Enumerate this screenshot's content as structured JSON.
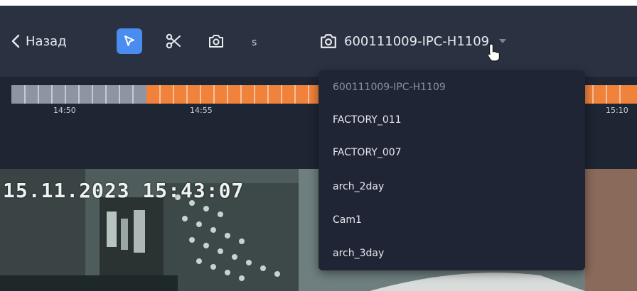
{
  "toolbar": {
    "back_label": "Назад",
    "s_label": "s",
    "camera_name": "600111009-IPC-H1109"
  },
  "timeline": {
    "labels": [
      "14:50",
      "14:55",
      "15:10"
    ],
    "colors": {
      "recorded": "#f0823c",
      "empty": "#8d95a3"
    }
  },
  "video": {
    "overlay_text": "15.11.2023 15:43:07"
  },
  "dropdown": {
    "items": [
      "600111009-IPC-H1109",
      "FACTORY_011",
      "FACTORY_007",
      "arch_2day",
      "Cam1",
      "arch_3day"
    ],
    "selected": "600111009-IPC-H1109"
  },
  "colors": {
    "accent": "#4a8cf0",
    "toolbar_bg": "#2a3242",
    "menu_bg": "#1f2534"
  }
}
